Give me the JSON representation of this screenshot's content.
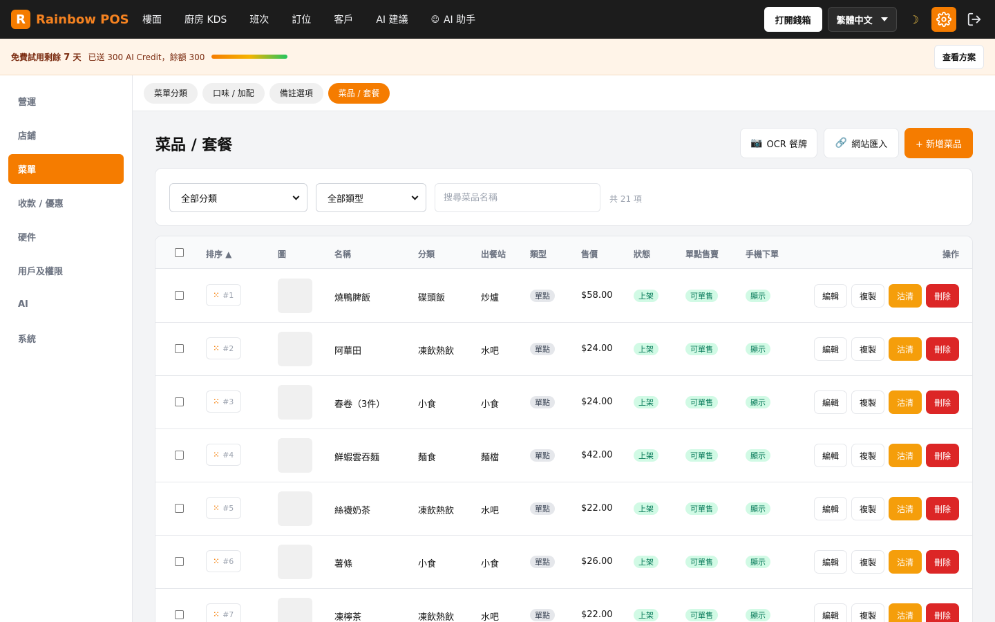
{
  "app": {
    "logo_letter": "R",
    "name": "Rainbow POS"
  },
  "nav": [
    {
      "label": "樓面",
      "icon": ""
    },
    {
      "label": "廚房 KDS",
      "icon": ""
    },
    {
      "label": "班次",
      "icon": ""
    },
    {
      "label": "訂位",
      "icon": ""
    },
    {
      "label": "客戶",
      "icon": ""
    },
    {
      "label": "AI 建議",
      "icon": ""
    },
    {
      "label": "AI 助手",
      "icon": "robot-icon"
    }
  ],
  "topbar": {
    "cash_drawer_label": "打開錢箱",
    "language_value": "繁體中文",
    "theme_icon": "moon-icon",
    "settings_icon": "gear-icon",
    "logout_icon": "logout-icon",
    "accent_color": "#f57c00"
  },
  "banner": {
    "trial_prefix": "免費試用剩餘",
    "trial_days": "7",
    "trial_suffix": "天",
    "credit_text": "已送 300 AI Credit，餘額 300",
    "credit_fraction": 1.0,
    "plan_button": "查看方案"
  },
  "sidebar": {
    "items": [
      {
        "label": "營運",
        "active": false
      },
      {
        "label": "店鋪",
        "active": false
      },
      {
        "label": "菜單",
        "active": true
      },
      {
        "label": "收款 / 優惠",
        "active": false
      },
      {
        "label": "硬件",
        "active": false
      },
      {
        "label": "用戶及權限",
        "active": false
      },
      {
        "label": "AI",
        "active": false
      },
      {
        "label": "系統",
        "active": false
      }
    ]
  },
  "subtabs": [
    {
      "label": "菜單分類",
      "active": false
    },
    {
      "label": "口味 / 加配",
      "active": false
    },
    {
      "label": "備註選項",
      "active": false
    },
    {
      "label": "菜品 / 套餐",
      "active": true
    }
  ],
  "page": {
    "title": "菜品 / 套餐",
    "ocr_button": "OCR 餐牌",
    "import_button": "網站匯入",
    "add_button": "+ 新增菜品"
  },
  "filters": {
    "category_value": "全部分類",
    "type_value": "全部類型",
    "search_placeholder": "搜尋菜品名稱",
    "count_text": "共 21 項"
  },
  "table": {
    "headers": {
      "sort": "排序 ▲",
      "image": "圖",
      "name": "名稱",
      "category": "分類",
      "station": "出餐站",
      "type": "類型",
      "price": "售價",
      "status": "狀態",
      "single_sale": "單點售賣",
      "mobile_order": "手機下單",
      "actions": "操作"
    },
    "action_labels": {
      "edit": "編輯",
      "copy": "複製",
      "sold_out": "沽清",
      "delete": "刪除"
    },
    "rows": [
      {
        "sort": "#1",
        "name": "燒鴨脾飯",
        "category": "碟頭飯",
        "station": "炒爐",
        "type": "單點",
        "price": "$58.00",
        "status": "上架",
        "single_sale": "可單售",
        "mobile": "顯示"
      },
      {
        "sort": "#2",
        "name": "阿華田",
        "category": "凍飲熱飲",
        "station": "水吧",
        "type": "單點",
        "price": "$24.00",
        "status": "上架",
        "single_sale": "可單售",
        "mobile": "顯示"
      },
      {
        "sort": "#3",
        "name": "春卷（3件）",
        "category": "小食",
        "station": "小食",
        "type": "單點",
        "price": "$24.00",
        "status": "上架",
        "single_sale": "可單售",
        "mobile": "顯示"
      },
      {
        "sort": "#4",
        "name": "鮮蝦雲吞麵",
        "category": "麵食",
        "station": "麵檔",
        "type": "單點",
        "price": "$42.00",
        "status": "上架",
        "single_sale": "可單售",
        "mobile": "顯示"
      },
      {
        "sort": "#5",
        "name": "絲襪奶茶",
        "category": "凍飲熱飲",
        "station": "水吧",
        "type": "單點",
        "price": "$22.00",
        "status": "上架",
        "single_sale": "可單售",
        "mobile": "顯示"
      },
      {
        "sort": "#6",
        "name": "薯條",
        "category": "小食",
        "station": "小食",
        "type": "單點",
        "price": "$26.00",
        "status": "上架",
        "single_sale": "可單售",
        "mobile": "顯示"
      },
      {
        "sort": "#7",
        "name": "凍檸茶",
        "category": "凍飲熱飲",
        "station": "水吧",
        "type": "單點",
        "price": "$22.00",
        "status": "上架",
        "single_sale": "可單售",
        "mobile": "顯示"
      }
    ]
  }
}
